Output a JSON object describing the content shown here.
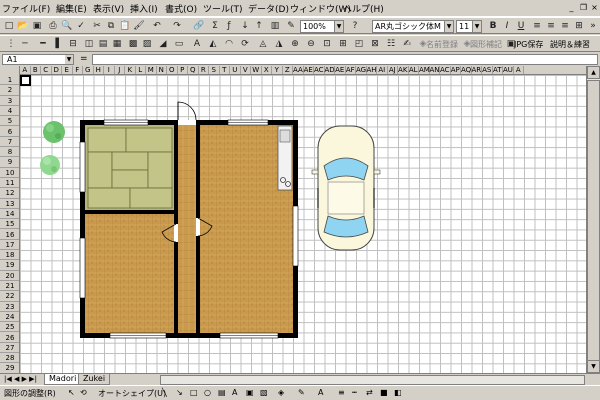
{
  "menu": {
    "items": [
      "ファイル(F)",
      "編集(E)",
      "表示(V)",
      "挿入(I)",
      "書式(O)",
      "ツール(T)",
      "データ(D)",
      "ウィンドウ(W)",
      "ヘルプ(H)"
    ]
  },
  "toolbar": {
    "zoom": "100%",
    "font_name": "AR丸ゴシック体M",
    "font_size": "11",
    "bring_front_label": "名前登録",
    "shape_edit_label": "図形補記",
    "jpg_save_label": "JPG保存",
    "help_label": "説明＆練習"
  },
  "formula": {
    "name_box": "A1",
    "eq": "="
  },
  "grid": {
    "columns": [
      "A",
      "B",
      "C",
      "D",
      "E",
      "F",
      "G",
      "H",
      "I",
      "J",
      "K",
      "L",
      "M",
      "N",
      "O",
      "P",
      "Q",
      "R",
      "S",
      "T",
      "U",
      "V",
      "W",
      "X",
      "Y",
      "Z",
      "AA",
      "AE",
      "AC",
      "AD",
      "AE",
      "AF",
      "AG",
      "AH",
      "AI",
      "AJ",
      "AK",
      "AL",
      "AM",
      "AN",
      "AC",
      "AP",
      "AQ",
      "AR",
      "AS",
      "AT",
      "AU",
      "A"
    ],
    "rows": [
      "1",
      "2",
      "3",
      "4",
      "5",
      "6",
      "7",
      "8",
      "9",
      "10",
      "11",
      "12",
      "13",
      "14",
      "15",
      "16",
      "17",
      "18",
      "19",
      "20",
      "21",
      "22",
      "23",
      "24",
      "25",
      "26",
      "27",
      "28",
      "29"
    ]
  },
  "tabs": {
    "nav": "|◀ ◀ ▶ ▶|",
    "sheet1": "Madori",
    "sheet2": "Zukei"
  },
  "drawing": {
    "adjust_label": "図形の調整(R)",
    "autoshape_label": "オートシェイプ(U)"
  },
  "colors": {
    "wall": "#000000",
    "tatami": "#b5b87a",
    "flooring": "#c99a4d",
    "tree": "#6cc16c",
    "grid_line": "#c0c0c0"
  }
}
